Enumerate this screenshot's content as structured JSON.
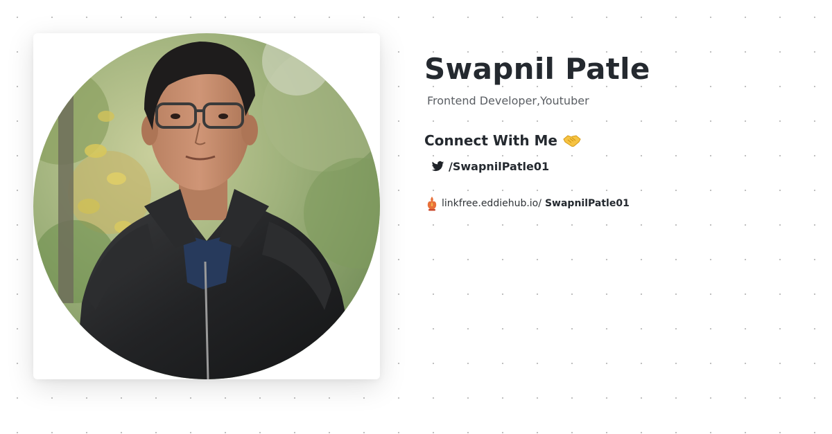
{
  "profile": {
    "name": "Swapnil Patle",
    "tagline": "Frontend Developer,Youtuber",
    "photo_icon": "profile-photo"
  },
  "connect": {
    "heading": "Connect With Me",
    "icon": "handshake-icon"
  },
  "socials": [
    {
      "platform": "twitter",
      "icon": "twitter-icon",
      "handle": "/SwapnilPatle01"
    }
  ],
  "linkfree": {
    "icon": "eddiehub-logo-icon",
    "domain": "linkfree.eddiehub.io/",
    "username": "SwapnilPatle01"
  },
  "colors": {
    "background": "#ffffff",
    "dot_grid": "#b8b8b8",
    "text_primary": "#24292f",
    "text_secondary": "#5a5e63",
    "twitter": "#1f2328"
  }
}
